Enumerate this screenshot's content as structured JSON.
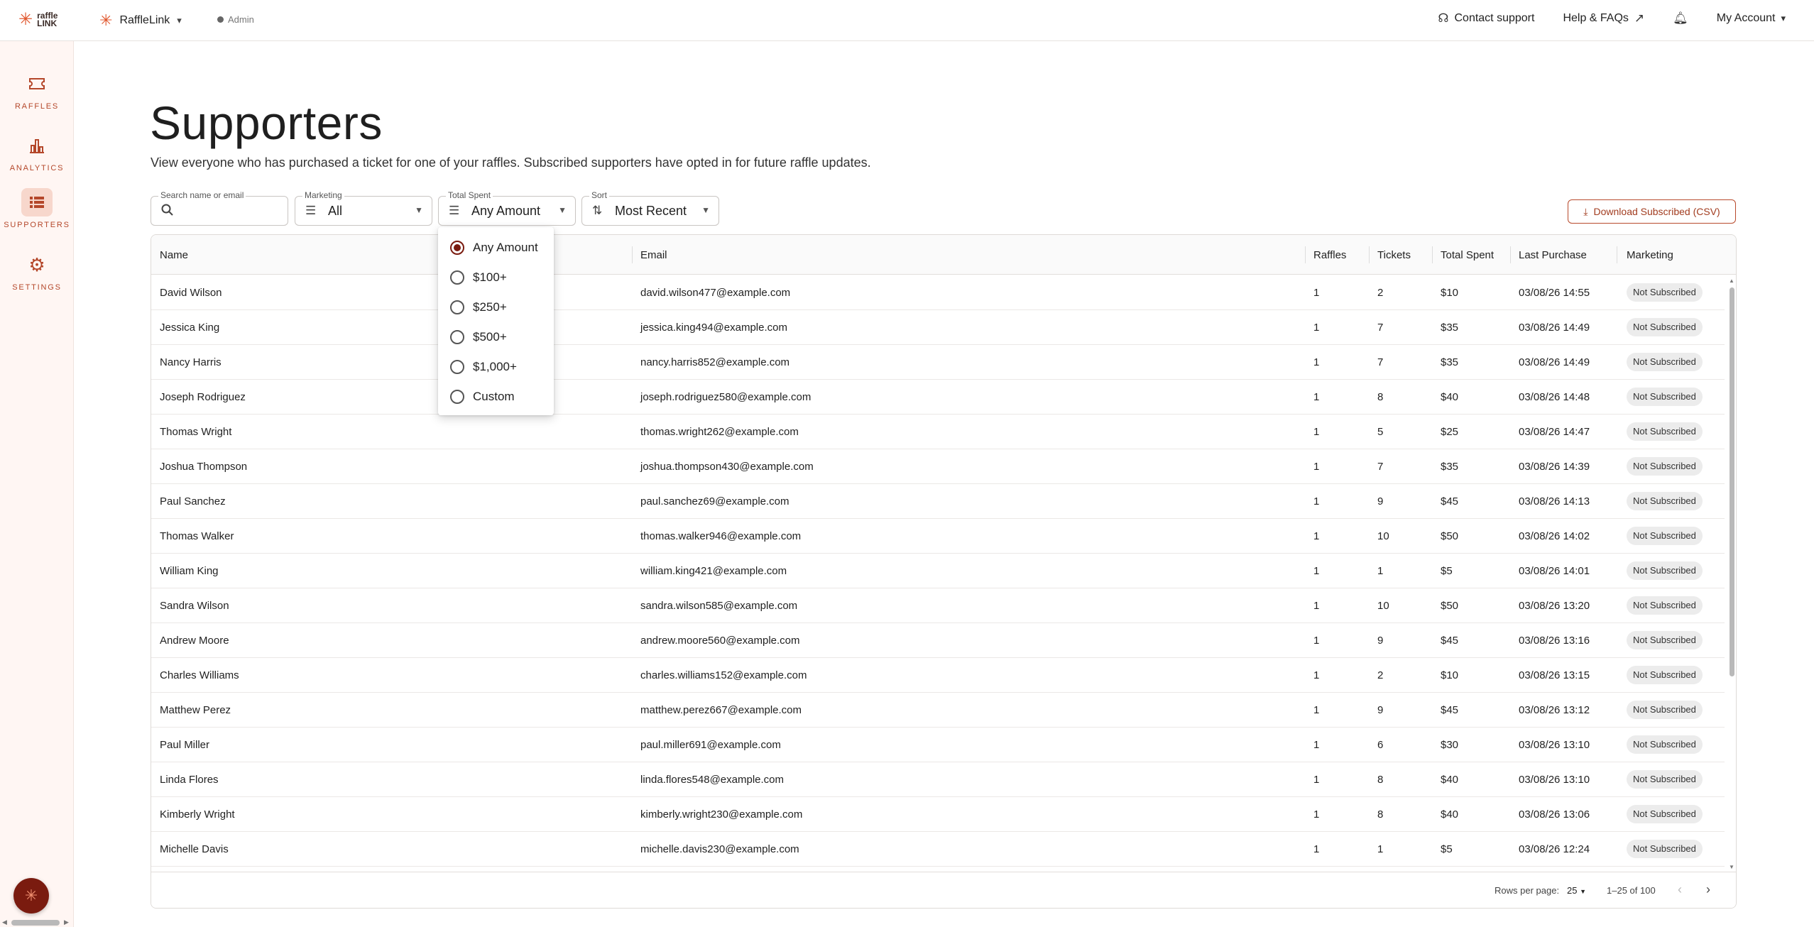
{
  "brand": {
    "line1": "raffle",
    "line2": "LINK"
  },
  "org": {
    "name": "RaffleLink",
    "role": "Admin"
  },
  "topnav": {
    "support": "Contact support",
    "help": "Help & FAQs",
    "account": "My Account"
  },
  "sidebar": {
    "items": [
      {
        "label": "RAFFLES",
        "icon": "ticket-icon"
      },
      {
        "label": "ANALYTICS",
        "icon": "bar-chart-icon"
      },
      {
        "label": "SUPPORTERS",
        "icon": "list-icon"
      },
      {
        "label": "SETTINGS",
        "icon": "gear-icon"
      }
    ]
  },
  "page": {
    "title": "Supporters",
    "subtitle": "View everyone who has purchased a ticket for one of your raffles. Subscribed supporters have opted in for future raffle updates."
  },
  "filters": {
    "search": {
      "label": "Search name or email",
      "placeholder": ""
    },
    "marketing": {
      "label": "Marketing",
      "value": "All"
    },
    "total_spent": {
      "label": "Total Spent",
      "value": "Any Amount"
    },
    "sort": {
      "label": "Sort",
      "value": "Most Recent"
    }
  },
  "download_button": "Download Subscribed (CSV)",
  "dropdown": {
    "options": [
      "Any Amount",
      "$100+",
      "$250+",
      "$500+",
      "$1,000+",
      "Custom"
    ],
    "selected": "Any Amount"
  },
  "table": {
    "columns": [
      "Name",
      "Email",
      "Raffles",
      "Tickets",
      "Total Spent",
      "Last Purchase",
      "Marketing"
    ],
    "rows": [
      [
        "David Wilson",
        "david.wilson477@example.com",
        "1",
        "2",
        "$10",
        "03/08/26 14:55",
        "Not Subscribed"
      ],
      [
        "Jessica King",
        "jessica.king494@example.com",
        "1",
        "7",
        "$35",
        "03/08/26 14:49",
        "Not Subscribed"
      ],
      [
        "Nancy Harris",
        "nancy.harris852@example.com",
        "1",
        "7",
        "$35",
        "03/08/26 14:49",
        "Not Subscribed"
      ],
      [
        "Joseph Rodriguez",
        "joseph.rodriguez580@example.com",
        "1",
        "8",
        "$40",
        "03/08/26 14:48",
        "Not Subscribed"
      ],
      [
        "Thomas Wright",
        "thomas.wright262@example.com",
        "1",
        "5",
        "$25",
        "03/08/26 14:47",
        "Not Subscribed"
      ],
      [
        "Joshua Thompson",
        "joshua.thompson430@example.com",
        "1",
        "7",
        "$35",
        "03/08/26 14:39",
        "Not Subscribed"
      ],
      [
        "Paul Sanchez",
        "paul.sanchez69@example.com",
        "1",
        "9",
        "$45",
        "03/08/26 14:13",
        "Not Subscribed"
      ],
      [
        "Thomas Walker",
        "thomas.walker946@example.com",
        "1",
        "10",
        "$50",
        "03/08/26 14:02",
        "Not Subscribed"
      ],
      [
        "William King",
        "william.king421@example.com",
        "1",
        "1",
        "$5",
        "03/08/26 14:01",
        "Not Subscribed"
      ],
      [
        "Sandra Wilson",
        "sandra.wilson585@example.com",
        "1",
        "10",
        "$50",
        "03/08/26 13:20",
        "Not Subscribed"
      ],
      [
        "Andrew Moore",
        "andrew.moore560@example.com",
        "1",
        "9",
        "$45",
        "03/08/26 13:16",
        "Not Subscribed"
      ],
      [
        "Charles Williams",
        "charles.williams152@example.com",
        "1",
        "2",
        "$10",
        "03/08/26 13:15",
        "Not Subscribed"
      ],
      [
        "Matthew Perez",
        "matthew.perez667@example.com",
        "1",
        "9",
        "$45",
        "03/08/26 13:12",
        "Not Subscribed"
      ],
      [
        "Paul Miller",
        "paul.miller691@example.com",
        "1",
        "6",
        "$30",
        "03/08/26 13:10",
        "Not Subscribed"
      ],
      [
        "Linda Flores",
        "linda.flores548@example.com",
        "1",
        "8",
        "$40",
        "03/08/26 13:10",
        "Not Subscribed"
      ],
      [
        "Kimberly Wright",
        "kimberly.wright230@example.com",
        "1",
        "8",
        "$40",
        "03/08/26 13:06",
        "Not Subscribed"
      ],
      [
        "Michelle Davis",
        "michelle.davis230@example.com",
        "1",
        "1",
        "$5",
        "03/08/26 12:24",
        "Not Subscribed"
      ]
    ]
  },
  "pagination": {
    "rows_per_page_label": "Rows per page:",
    "rows_per_page": "25",
    "range": "1–25 of 100"
  },
  "colors": {
    "accent": "#b4472a",
    "brand_dark": "#7a1b0f",
    "sidebar_bg": "#fff6f3"
  }
}
